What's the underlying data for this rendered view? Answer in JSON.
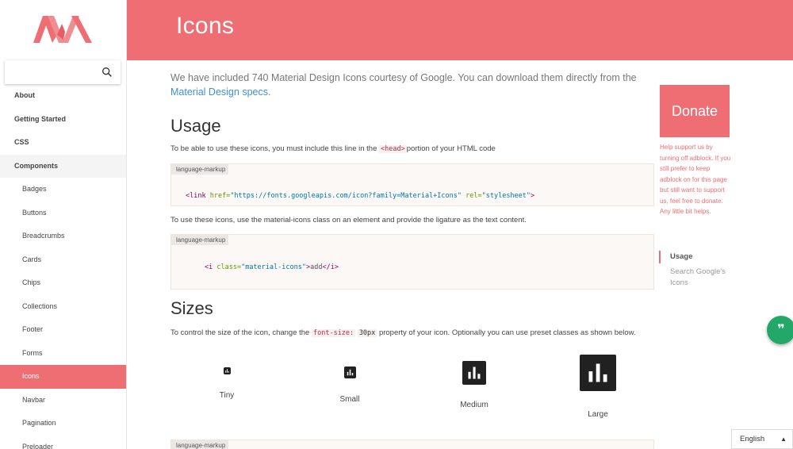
{
  "page": {
    "title": "Icons"
  },
  "search": {
    "placeholder": ""
  },
  "sidebar": {
    "items": [
      {
        "label": "About",
        "type": "top"
      },
      {
        "label": "Getting Started",
        "type": "top"
      },
      {
        "label": "CSS",
        "type": "top"
      },
      {
        "label": "Components",
        "type": "top",
        "expanded": true
      },
      {
        "label": "Badges",
        "type": "sub"
      },
      {
        "label": "Buttons",
        "type": "sub"
      },
      {
        "label": "Breadcrumbs",
        "type": "sub"
      },
      {
        "label": "Cards",
        "type": "sub"
      },
      {
        "label": "Chips",
        "type": "sub"
      },
      {
        "label": "Collections",
        "type": "sub"
      },
      {
        "label": "Footer",
        "type": "sub"
      },
      {
        "label": "Forms",
        "type": "sub"
      },
      {
        "label": "Icons",
        "type": "sub",
        "active": true
      },
      {
        "label": "Navbar",
        "type": "sub"
      },
      {
        "label": "Pagination",
        "type": "sub"
      },
      {
        "label": "Preloader",
        "type": "sub"
      }
    ]
  },
  "main": {
    "intro_text": "We have included 740 Material Design Icons courtesy of Google. You can download them directly from the",
    "intro_link": "Material Design specs",
    "intro_end": ".",
    "usage": {
      "heading": "Usage",
      "p1_before": "To be able to use these icons, you must include this line in the",
      "p1_code": "<head>",
      "p1_after": "portion of your HTML code",
      "code1_lang": "language-markup",
      "code1_tag_open": "<link",
      "code1_attr1": " href=",
      "code1_val1": "\"https://fonts.googleapis.com/icon?family=Material+Icons\"",
      "code1_attr2": " rel=",
      "code1_val2": "\"stylesheet\"",
      "code1_tag_close": ">",
      "p2": "To use these icons, use the material-icons class on an element and provide the ligature as the text content.",
      "code2_lang": "language-markup",
      "code2_tag_open": "<i",
      "code2_attr": " class=",
      "code2_val": "\"material-icons\"",
      "code2_tag_mid": ">",
      "code2_text": "add",
      "code2_tag_close": "</i>"
    },
    "sizes": {
      "heading": "Sizes",
      "p_before": "To control the size of the icon, change the",
      "p_code": "font-size:",
      "p_code2": "30px",
      "p_after": "property of your icon. Optionally you can use preset classes as shown below.",
      "demos": [
        {
          "label": "Tiny"
        },
        {
          "label": "Small"
        },
        {
          "label": "Medium"
        },
        {
          "label": "Large"
        }
      ],
      "code3_lang": "language-markup"
    }
  },
  "right": {
    "donate_label": "Donate",
    "donate_note": "Help support us by turning off adblock. If you still prefer to keep adblock on for this page but still want to support us, feel free to donate. Any little bit helps.",
    "toc": [
      {
        "label": "Usage",
        "active": true
      },
      {
        "label": "Search Google's Icons",
        "active": false
      }
    ]
  },
  "fab": {
    "icon": "quote-icon",
    "glyph": "❞"
  },
  "language": {
    "selected": "English",
    "arrow": "▲"
  },
  "colors": {
    "accent": "#ee6e73",
    "fab": "#23a86a",
    "link": "#3e8fd4"
  }
}
